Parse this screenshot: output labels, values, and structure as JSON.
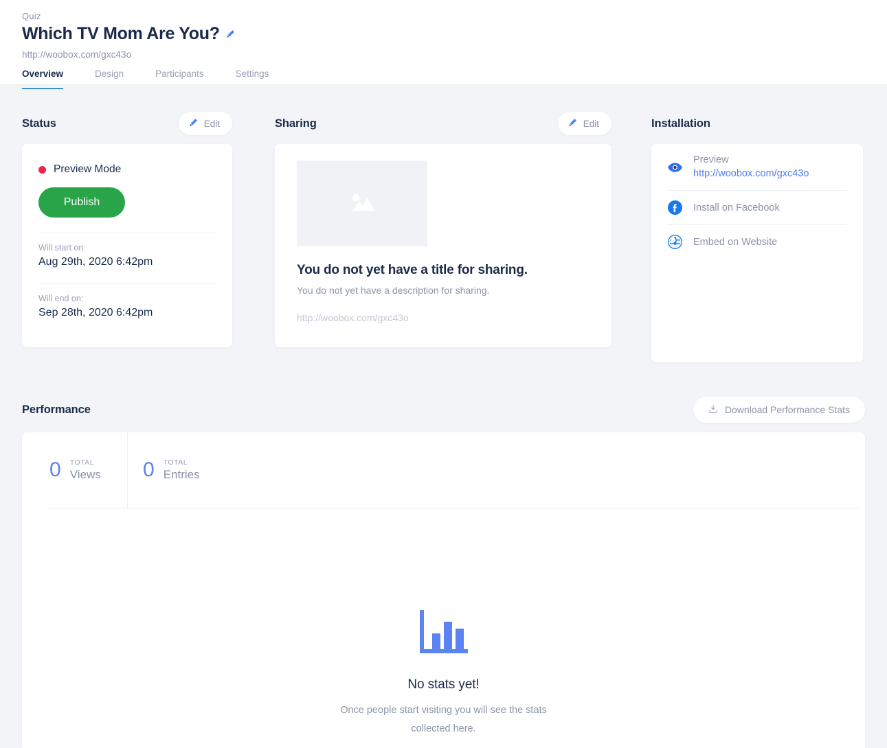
{
  "header": {
    "kicker": "Quiz",
    "title": "Which TV Mom Are You?",
    "url": "http://woobox.com/gxc43o",
    "edit_title_icon": "pencil-icon",
    "tabs": [
      {
        "label": "Overview",
        "active": true
      },
      {
        "label": "Design",
        "active": false
      },
      {
        "label": "Participants",
        "active": false
      },
      {
        "label": "Settings",
        "active": false
      }
    ]
  },
  "status": {
    "section_title": "Status",
    "edit_label": "Edit",
    "edit_icon": "pencil-icon",
    "mode_label": "Preview Mode",
    "mode_dot_color": "#f0234c",
    "publish_label": "Publish",
    "publish_color": "#2aa449",
    "start_label": "Will start on:",
    "start_value": "Aug 29th, 2020 6:42pm",
    "end_label": "Will end on:",
    "end_value": "Sep 28th, 2020 6:42pm"
  },
  "sharing": {
    "section_title": "Sharing",
    "edit_label": "Edit",
    "edit_icon": "pencil-icon",
    "image_placeholder_icon": "image-icon",
    "title": "You do not yet have a title for sharing.",
    "description": "You do not yet have a description for sharing.",
    "url": "http://woobox.com/gxc43o"
  },
  "installation": {
    "section_title": "Installation",
    "items": [
      {
        "icon": "eye-icon",
        "label": "Preview",
        "link": "http://woobox.com/gxc43o"
      },
      {
        "icon": "facebook-icon",
        "label": "Install on Facebook",
        "link": ""
      },
      {
        "icon": "globe-icon",
        "label": "Embed on Website",
        "link": ""
      }
    ]
  },
  "performance": {
    "section_title": "Performance",
    "download_label": "Download Performance Stats",
    "download_icon": "download-icon",
    "stats": [
      {
        "value": "0",
        "total": "TOTAL",
        "label": "Views"
      },
      {
        "value": "0",
        "total": "TOTAL",
        "label": "Entries"
      }
    ],
    "empty_icon": "bar-chart-icon",
    "empty_title": "No stats yet!",
    "empty_subtitle": "Once people start visiting you will see the stats collected here.",
    "accent_color": "#5b84f2"
  }
}
